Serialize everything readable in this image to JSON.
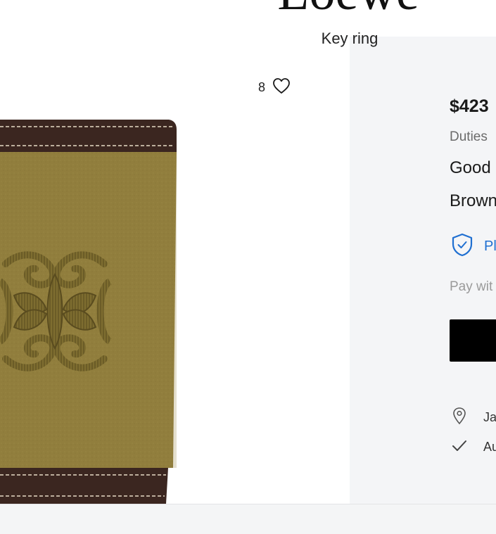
{
  "product": {
    "brand": "Loewe",
    "name": "Key ring",
    "likes": "8",
    "price": "$423",
    "duties": "Duties",
    "condition": "Good",
    "color": "Brown"
  },
  "protection": {
    "label": "Pl",
    "accent_color": "#1f6fd1"
  },
  "payment": {
    "label": "Pay wit"
  },
  "meta": {
    "location": "Ja",
    "authentication": "Au"
  },
  "icons": {
    "favorite": "heart-icon",
    "protection": "shield-check-icon",
    "location": "map-pin-icon",
    "authentication": "checkmark-icon"
  }
}
